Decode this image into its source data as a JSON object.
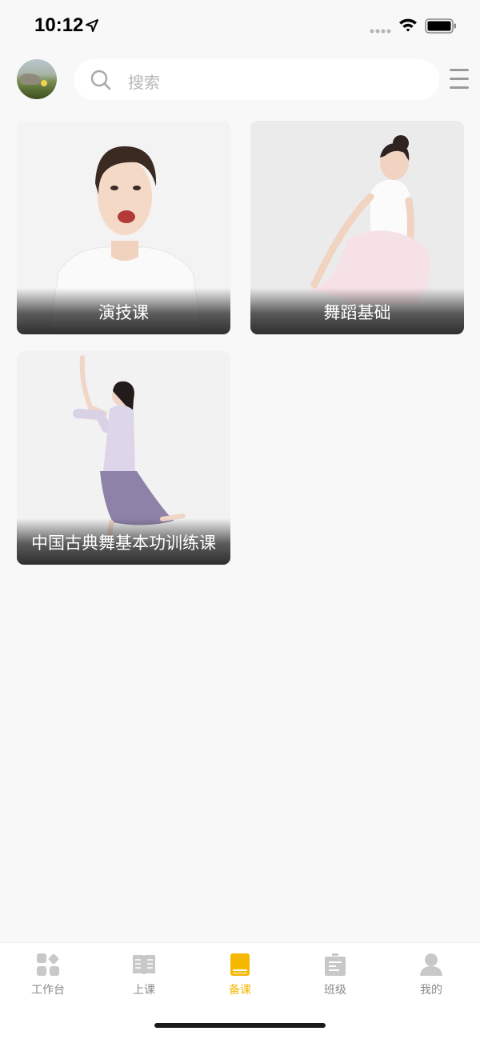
{
  "status_bar": {
    "time": "10:12"
  },
  "header": {
    "search_placeholder": "搜索"
  },
  "courses": [
    {
      "title": "演技课"
    },
    {
      "title": "舞蹈基础"
    },
    {
      "title": "中国古典舞基本功训练课"
    }
  ],
  "tab_bar": {
    "tabs": [
      {
        "label": "工作台",
        "icon": "workbench-icon"
      },
      {
        "label": "上课",
        "icon": "open-book-icon"
      },
      {
        "label": "备课",
        "icon": "prep-book-icon"
      },
      {
        "label": "班级",
        "icon": "class-board-icon"
      },
      {
        "label": "我的",
        "icon": "person-icon"
      }
    ],
    "active_index": 2,
    "active_color": "#f6b700",
    "inactive_color": "#c8c8c8"
  }
}
